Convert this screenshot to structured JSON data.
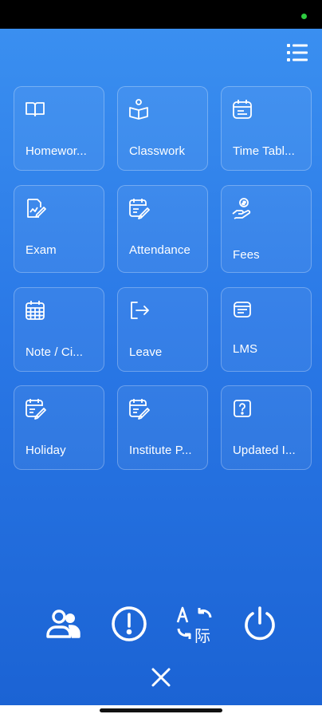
{
  "header": {
    "menu_icon": "list-menu-icon"
  },
  "tiles": [
    {
      "label": "Homewor...",
      "icon": "book-icon"
    },
    {
      "label": "Classwork",
      "icon": "reader-icon"
    },
    {
      "label": "Time Tabl...",
      "icon": "calendar-icon"
    },
    {
      "label": "Exam",
      "icon": "exam-icon"
    },
    {
      "label": "Attendance",
      "icon": "attendance-icon"
    },
    {
      "label": "Fees",
      "icon": "fees-icon"
    },
    {
      "label": "Note / Ci...",
      "icon": "grid-calendar-icon"
    },
    {
      "label": "Leave",
      "icon": "logout-arrow-icon"
    },
    {
      "label": "LMS",
      "icon": "lms-icon"
    },
    {
      "label": "Holiday",
      "icon": "holiday-icon"
    },
    {
      "label": "Institute P...",
      "icon": "institute-icon"
    },
    {
      "label": "Updated I...",
      "icon": "help-icon"
    }
  ],
  "bottom_actions": [
    {
      "icon": "users-icon"
    },
    {
      "icon": "alert-icon"
    },
    {
      "icon": "translate-icon"
    },
    {
      "icon": "power-icon"
    }
  ],
  "close": {
    "icon": "close-icon"
  },
  "colors": {
    "gradient_top": "#3a8ff0",
    "gradient_bottom": "#1b63d4",
    "status_dot": "#2ecc40"
  }
}
